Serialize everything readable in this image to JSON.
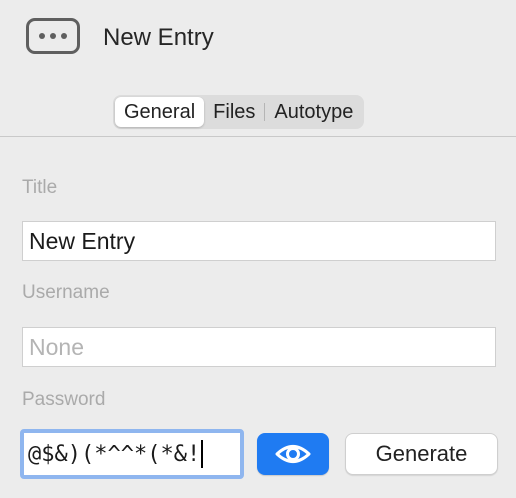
{
  "header": {
    "icon": "ellipsis-box-icon",
    "title": "New Entry"
  },
  "tabs": [
    {
      "label": "General",
      "active": true
    },
    {
      "label": "Files",
      "active": false
    },
    {
      "label": "Autotype",
      "active": false
    }
  ],
  "fields": {
    "title": {
      "label": "Title",
      "value": "New Entry"
    },
    "username": {
      "label": "Username",
      "value": "",
      "placeholder": "None"
    },
    "password": {
      "label": "Password",
      "value": "@$&)(*^^*(*&!"
    }
  },
  "buttons": {
    "reveal_icon": "eye-icon",
    "generate_label": "Generate"
  },
  "colors": {
    "accent": "#1f7bf2",
    "focus_ring": "#8fb6ef",
    "background": "#ececec"
  }
}
